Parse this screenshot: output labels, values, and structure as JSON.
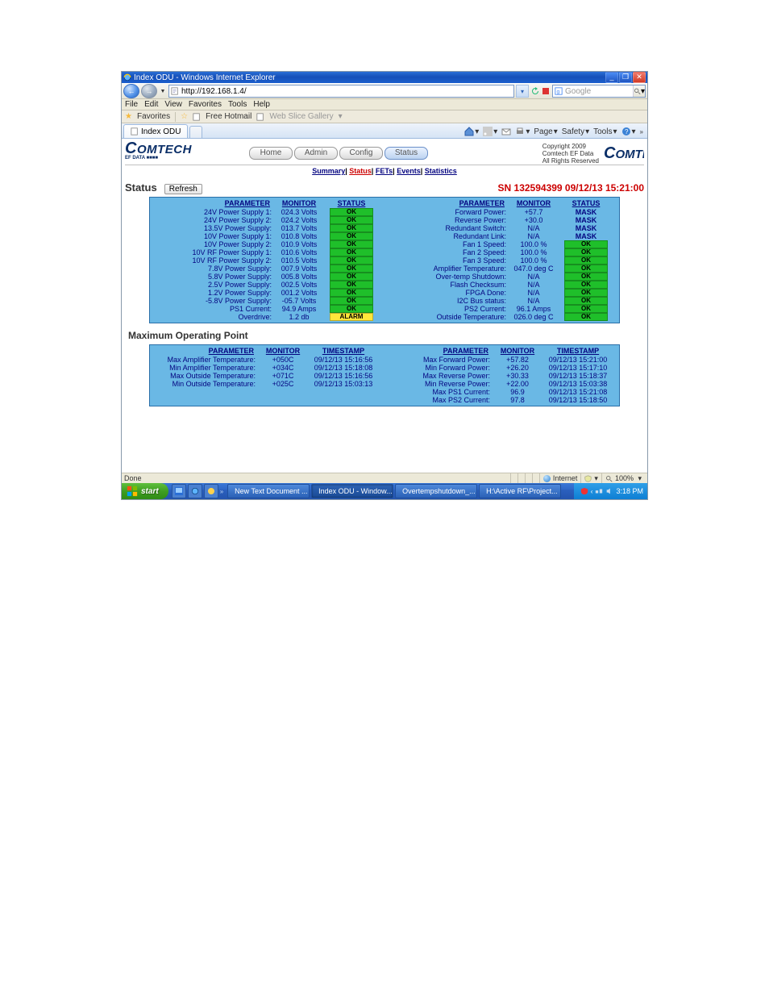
{
  "window": {
    "title": "Index ODU - Windows Internet Explorer"
  },
  "addressbar": {
    "url": "http://192.168.1.4/"
  },
  "searchbox": {
    "placeholder": "Google"
  },
  "menus": {
    "file": "File",
    "edit": "Edit",
    "view": "View",
    "favorites": "Favorites",
    "tools": "Tools",
    "help": "Help"
  },
  "favbar": {
    "label": "Favorites",
    "free_hotmail": "Free Hotmail",
    "wsg": "Web Slice Gallery"
  },
  "tab": {
    "title": "Index ODU"
  },
  "tabtools": {
    "page": "Page",
    "safety": "Safety",
    "tools": "Tools"
  },
  "banner": {
    "brand": "COMTECH",
    "sub": "EF DATA ■■■■",
    "home": "Home",
    "admin": "Admin",
    "config": "Config",
    "status": "Status",
    "copyright_l1": "Copyright 2009",
    "copyright_l2": "Comtech EF Data",
    "copyright_l3": "All Rights Reserved",
    "brand_r": "COMTE"
  },
  "subnav": {
    "summary": "Summary",
    "status": "Status",
    "fets": "FETs",
    "events": "Events",
    "statistics": "Statistics"
  },
  "status_section": {
    "label": "Status",
    "refresh": "Refresh",
    "sn": "SN 132594399 09/12/13 15:21:00"
  },
  "headers": {
    "parameter": "PARAMETER",
    "monitor": "MONITOR",
    "status": "STATUS",
    "timestamp": "TIMESTAMP"
  },
  "status_left": [
    {
      "p": "24V Power Supply 1:",
      "m": "024.3 Volts",
      "s": "OK"
    },
    {
      "p": "24V Power Supply 2:",
      "m": "024.2 Volts",
      "s": "OK"
    },
    {
      "p": "13.5V Power Supply:",
      "m": "013.7 Volts",
      "s": "OK"
    },
    {
      "p": "10V Power Supply 1:",
      "m": "010.8 Volts",
      "s": "OK"
    },
    {
      "p": "10V Power Supply 2:",
      "m": "010.9 Volts",
      "s": "OK"
    },
    {
      "p": "10V RF Power Supply 1:",
      "m": "010.6 Volts",
      "s": "OK"
    },
    {
      "p": "10V RF Power Supply 2:",
      "m": "010.5 Volts",
      "s": "OK"
    },
    {
      "p": "7.8V Power Supply:",
      "m": "007.9 Volts",
      "s": "OK"
    },
    {
      "p": "5.8V Power Supply:",
      "m": "005.8 Volts",
      "s": "OK"
    },
    {
      "p": "2.5V Power Supply:",
      "m": "002.5 Volts",
      "s": "OK"
    },
    {
      "p": "1.2V Power Supply:",
      "m": "001.2 Volts",
      "s": "OK"
    },
    {
      "p": "-5.8V Power Supply:",
      "m": "-05.7 Volts",
      "s": "OK"
    },
    {
      "p": "PS1 Current:",
      "m": "94.9 Amps",
      "s": "OK"
    },
    {
      "p": "Overdrive:",
      "m": "1.2 db",
      "s": "ALARM"
    }
  ],
  "status_right": [
    {
      "p": "Forward Power:",
      "m": "+57.7",
      "s": "MASK"
    },
    {
      "p": "Reverse Power:",
      "m": "+30.0",
      "s": "MASK"
    },
    {
      "p": "Redundant Switch:",
      "m": "N/A",
      "s": "MASK"
    },
    {
      "p": "Redundant Link:",
      "m": "N/A",
      "s": "MASK"
    },
    {
      "p": "Fan 1 Speed:",
      "m": "100.0 %",
      "s": "OK"
    },
    {
      "p": "Fan 2 Speed:",
      "m": "100.0 %",
      "s": "OK"
    },
    {
      "p": "Fan 3 Speed:",
      "m": "100.0 %",
      "s": "OK"
    },
    {
      "p": "Amplifier Temperature:",
      "m": "047.0 deg C",
      "s": "OK"
    },
    {
      "p": "Over-temp Shutdown:",
      "m": "N/A",
      "s": "OK"
    },
    {
      "p": "Flash Checksum:",
      "m": "N/A",
      "s": "OK"
    },
    {
      "p": "FPGA Done:",
      "m": "N/A",
      "s": "OK"
    },
    {
      "p": "I2C Bus status:",
      "m": "N/A",
      "s": "OK"
    },
    {
      "p": "PS2 Current:",
      "m": "96.1 Amps",
      "s": "OK"
    },
    {
      "p": "Outside Temperature:",
      "m": "026.0 deg C",
      "s": "OK"
    }
  ],
  "mop": {
    "heading": "Maximum Operating Point",
    "left": [
      {
        "p": "Max Amplifier Temperature:",
        "m": "+050C",
        "t": "09/12/13 15:16:56"
      },
      {
        "p": "Min Amplifier Temperature:",
        "m": "+034C",
        "t": "09/12/13 15:18:08"
      },
      {
        "p": "Max Outside Temperature:",
        "m": "+071C",
        "t": "09/12/13 15:16:56"
      },
      {
        "p": "Min Outside Temperature:",
        "m": "+025C",
        "t": "09/12/13 15:03:13"
      }
    ],
    "right": [
      {
        "p": "Max Forward Power:",
        "m": "+57.82",
        "t": "09/12/13 15:21:00"
      },
      {
        "p": "Min Forward Power:",
        "m": "+26.20",
        "t": "09/12/13 15:17:10"
      },
      {
        "p": "Max Reverse Power:",
        "m": "+30.33",
        "t": "09/12/13 15:18:37"
      },
      {
        "p": "Min Reverse Power:",
        "m": "+22.00",
        "t": "09/12/13 15:03:38"
      },
      {
        "p": "Max PS1 Current:",
        "m": "96.9",
        "t": "09/12/13 15:21:08"
      },
      {
        "p": "Max PS2 Current:",
        "m": "97.8",
        "t": "09/12/13 15:18:50"
      }
    ]
  },
  "ie_status": {
    "done": "Done",
    "zone": "Internet",
    "zoom": "100%"
  },
  "taskbar": {
    "start": "start",
    "btn1": "New Text Document ...",
    "btn2": "Index ODU - Window...",
    "btn3": "Overtempshutdown_...",
    "btn4": "H:\\Active RF\\Project...",
    "time": "3:18 PM"
  }
}
